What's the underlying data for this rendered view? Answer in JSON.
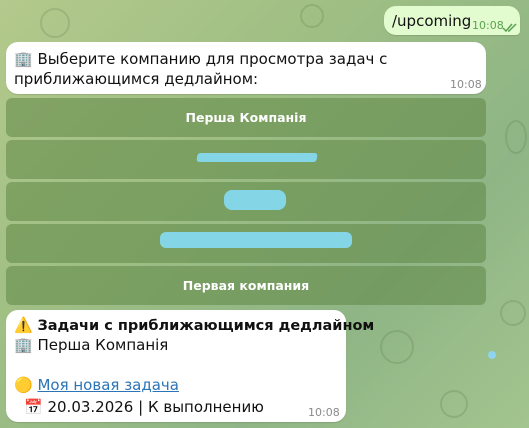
{
  "outgoing": {
    "text": "/upcoming",
    "time": "10:08"
  },
  "prompt_message": {
    "icon": "🏢",
    "text_line1": "Выберите компанию для просмотра задач с",
    "text_line2": "приближающимся дедлайном:",
    "time": "10:08"
  },
  "keyboard": {
    "buttons": [
      {
        "label": "Перша Компанія"
      },
      {
        "label": ""
      },
      {
        "label": ""
      },
      {
        "label": ""
      },
      {
        "label": "Первая компания"
      }
    ]
  },
  "tasks_message": {
    "warning_icon": "⚠️",
    "title": "Задачи с приближающимся дедлайном",
    "company_icon": "🏢",
    "company": "Перша Компанія",
    "task_icon": "🟡",
    "task_link": "Моя новая задача",
    "calendar_icon": "📅",
    "due": "20.03.2026 | К выполнению",
    "time": "10:08"
  },
  "colors": {
    "outgoing_bubble": "#e2fbcf",
    "incoming_bubble": "#ffffff",
    "link": "#2c74b6",
    "keyboard_button": "#6f8f5a"
  }
}
